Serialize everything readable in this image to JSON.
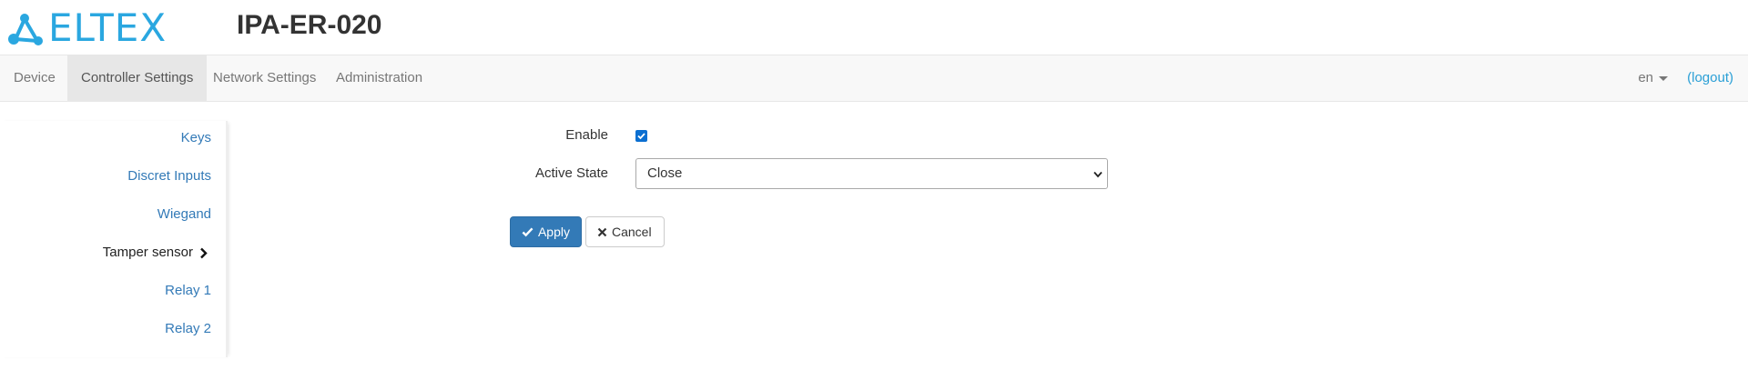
{
  "header": {
    "logo_text": "ELTEX",
    "device_title": "IPA-ER-020"
  },
  "navbar": {
    "items": [
      {
        "label": "Device"
      },
      {
        "label": "Controller Settings"
      },
      {
        "label": "Network Settings"
      },
      {
        "label": "Administration"
      }
    ],
    "active": "Controller Settings",
    "language": "en",
    "logout": "(logout)"
  },
  "sidebar": {
    "items": [
      {
        "label": "Keys"
      },
      {
        "label": "Discret Inputs"
      },
      {
        "label": "Wiegand"
      },
      {
        "label": "Tamper sensor"
      },
      {
        "label": "Relay 1"
      },
      {
        "label": "Relay 2"
      }
    ],
    "active": "Tamper sensor"
  },
  "form": {
    "enable_label": "Enable",
    "enable_checked": true,
    "active_state_label": "Active State",
    "active_state_value": "Close",
    "apply_label": "Apply",
    "cancel_label": "Cancel"
  },
  "colors": {
    "brand": "#2aa7e0",
    "link": "#337ab7",
    "primary_button": "#337ab7",
    "checkbox": "#0b6fd1"
  }
}
